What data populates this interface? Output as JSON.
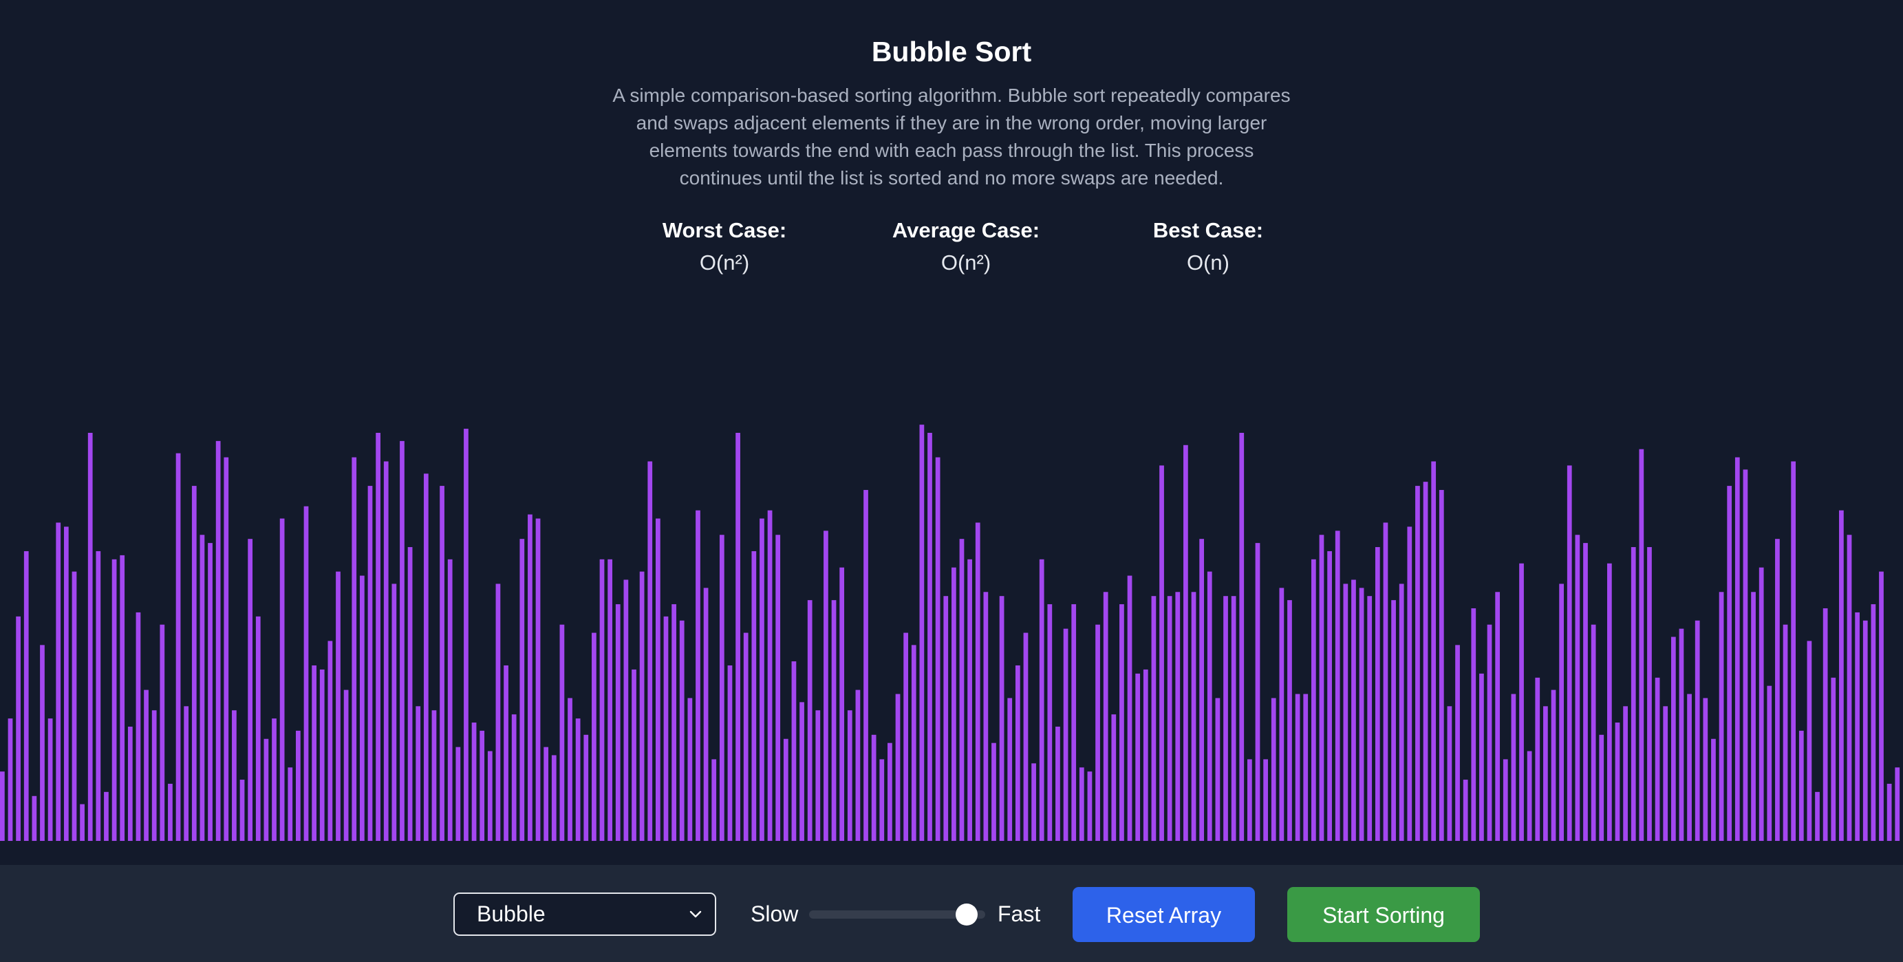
{
  "header": {
    "title": "Bubble Sort",
    "description": "A simple comparison-based sorting algorithm. Bubble sort repeatedly compares and swaps adjacent elements if they are in the wrong order, moving larger elements towards the end with each pass through the list. This process continues until the list is sorted and no more swaps are needed."
  },
  "complexity": {
    "worst": {
      "label": "Worst Case:",
      "value": "O(n²)"
    },
    "average": {
      "label": "Average Case:",
      "value": "O(n²)"
    },
    "best": {
      "label": "Best Case:",
      "value": "O(n)"
    }
  },
  "array": {
    "bar_color": "#a347f0",
    "max_value": 100,
    "values": [
      17,
      30,
      55,
      71,
      11,
      48,
      30,
      78,
      77,
      66,
      9,
      100,
      71,
      12,
      69,
      70,
      28,
      56,
      37,
      32,
      53,
      14,
      95,
      33,
      87,
      75,
      73,
      98,
      94,
      32,
      15,
      74,
      55,
      25,
      30,
      79,
      18,
      27,
      82,
      43,
      42,
      49,
      66,
      37,
      94,
      65,
      87,
      100,
      93,
      63,
      98,
      72,
      33,
      90,
      32,
      87,
      69,
      23,
      101,
      29,
      27,
      22,
      63,
      43,
      31,
      74,
      80,
      79,
      23,
      21,
      53,
      35,
      30,
      26,
      51,
      69,
      69,
      58,
      64,
      42,
      66,
      93,
      79,
      55,
      58,
      54,
      35,
      81,
      62,
      20,
      75,
      43,
      100,
      51,
      71,
      79,
      81,
      75,
      25,
      44,
      34,
      59,
      32,
      76,
      59,
      67,
      32,
      37,
      86,
      26,
      20,
      24,
      36,
      51,
      48,
      102,
      100,
      94,
      60,
      67,
      74,
      69,
      78,
      61,
      24,
      60,
      35,
      43,
      51,
      19,
      69,
      58,
      28,
      52,
      58,
      18,
      17,
      53,
      61,
      31,
      58,
      65,
      41,
      42,
      60,
      92,
      60,
      61,
      97,
      61,
      74,
      66,
      35,
      60,
      60,
      100,
      20,
      73,
      20,
      35,
      62,
      59,
      36,
      36,
      69,
      75,
      71,
      76,
      63,
      64,
      62,
      60,
      72,
      78,
      59,
      63,
      77,
      87,
      88,
      93,
      86,
      33,
      48,
      15,
      57,
      41,
      53,
      61,
      20,
      36,
      68,
      22,
      40,
      33,
      37,
      63,
      92,
      75,
      73,
      53,
      26,
      68,
      29,
      33,
      72,
      96,
      72,
      40,
      33,
      50,
      52,
      36,
      54,
      35,
      25,
      61,
      87,
      94,
      91,
      61,
      67,
      38,
      74,
      53,
      93,
      27,
      49,
      12,
      57,
      40,
      81,
      75,
      56,
      54,
      58,
      66,
      14,
      18
    ]
  },
  "controls": {
    "algorithm_select": {
      "value": "Bubble"
    },
    "speed": {
      "slow_label": "Slow",
      "fast_label": "Fast",
      "level": 0.95
    },
    "reset_label": "Reset Array",
    "start_label": "Start Sorting"
  }
}
